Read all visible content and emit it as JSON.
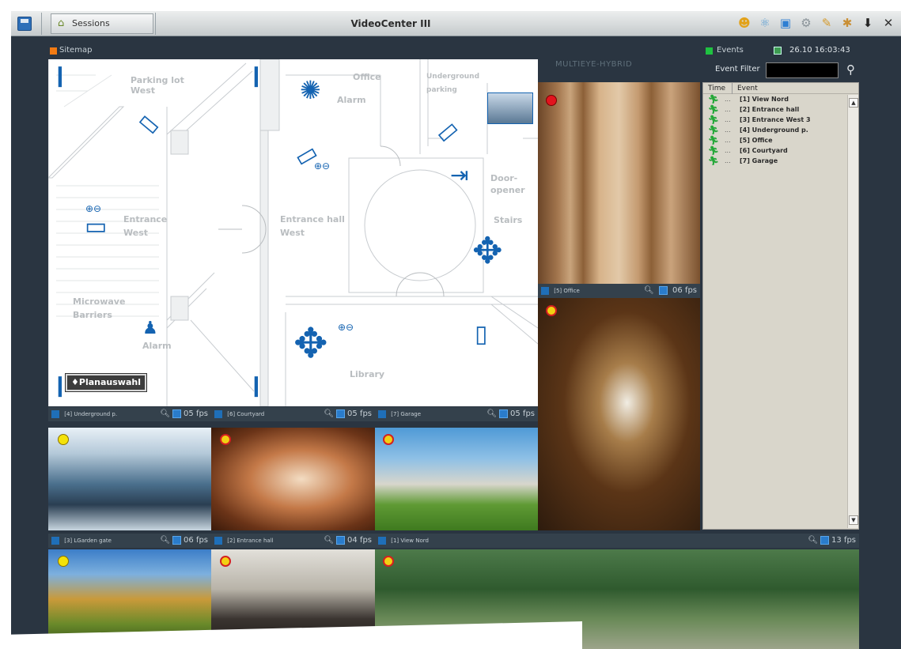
{
  "app": {
    "title": "VideoCenter III",
    "sessions_label": "Sessions"
  },
  "toolbar_icons": [
    "user-icon",
    "network-icon",
    "window-icon",
    "settings-icon",
    "tools-icon",
    "wizard-icon",
    "pin-icon",
    "close-icon"
  ],
  "sitemap": {
    "header": "Sitemap",
    "plan_button": "♦Planauswahl",
    "labels": {
      "parking_lot_1": "Parking lot",
      "parking_lot_2": "West",
      "office": "Office",
      "alarm_top": "Alarm",
      "underground_1": "Underground",
      "underground_2": "parking",
      "door_1": "Door-",
      "door_2": "opener",
      "stairs": "Stairs",
      "entrance_w_1": "Entrance",
      "entrance_w_2": "West",
      "hall_1": "Entrance hall",
      "hall_2": "West",
      "microwave_1": "Microwave",
      "microwave_2": "Barriers",
      "alarm_bottom": "Alarm",
      "library": "Library"
    }
  },
  "right_header": "MULTIEYE-HYBRID",
  "cameras": {
    "office": {
      "label": "[5] Office",
      "fps": "06 fps"
    },
    "underground": {
      "label": "[4] Underground p.",
      "fps": "05 fps"
    },
    "courtyard": {
      "label": "[6] Courtyard",
      "fps": "05 fps"
    },
    "garage": {
      "label": "[7] Garage",
      "fps": "05 fps"
    },
    "garden_gate": {
      "label": "[3] LGarden gate",
      "fps": "06 fps"
    },
    "entrance_hall": {
      "label": "[2] Entrance hall",
      "fps": "04 fps"
    },
    "view_nord": {
      "label": "[1] View Nord",
      "fps": "13 fps"
    }
  },
  "events": {
    "header": "Events",
    "timestamp": "26.10 16:03:43",
    "filter_label": "Event Filter",
    "filter_value": "",
    "col_time": "Time",
    "col_event": "Event",
    "rows": [
      {
        "time": "...",
        "event": "[1] View Nord"
      },
      {
        "time": "...",
        "event": "[2] Entrance hall"
      },
      {
        "time": "...",
        "event": "[3] Entrance West 3"
      },
      {
        "time": "...",
        "event": "[4] Underground p."
      },
      {
        "time": "...",
        "event": "[5] Office"
      },
      {
        "time": "...",
        "event": "[6] Courtyard"
      },
      {
        "time": "...",
        "event": "[7] Garage"
      }
    ]
  }
}
